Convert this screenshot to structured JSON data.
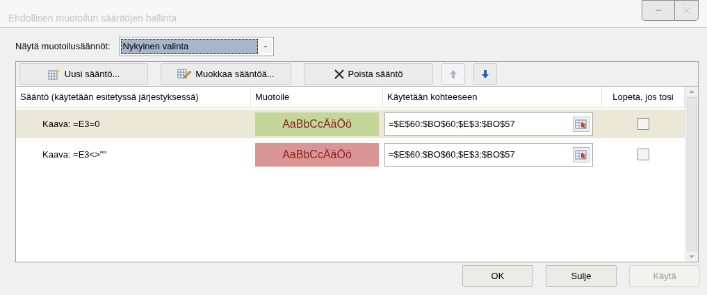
{
  "window": {
    "title": "Ehdollisen muotoilun sääntöjen hallinta"
  },
  "show_rules": {
    "label": "Näytä muotoilusäännöt:",
    "value": "Nykyinen valinta"
  },
  "toolbar": [
    {
      "kind": "new",
      "label": "Uusi sääntö...",
      "disabled": false
    },
    {
      "kind": "edit",
      "label": "Muokkaa sääntöä...",
      "disabled": false
    },
    {
      "kind": "delete",
      "label": "Poista sääntö",
      "disabled": false
    },
    {
      "kind": "up",
      "disabled": true
    },
    {
      "kind": "down",
      "disabled": false
    }
  ],
  "table": {
    "columns": [
      "Sääntö (käytetään esitetyssä järjestyksessä)",
      "Muotoile",
      "Käytetään kohteeseen",
      "Lopeta, jos tosi"
    ],
    "rows": [
      {
        "rule": "Kaava: =E3=0",
        "preview": "AaBbCcÄäÖö",
        "color": "#c4d79b",
        "applies_to": "=$E$60:$BO$60;$E$3:$BO$57",
        "stop_if_true": false,
        "selected": true
      },
      {
        "rule": "Kaava: =E3<>\"\"",
        "preview": "AaBbCcÄäÖö",
        "color": "#da9694",
        "applies_to": "=$E$60:$BO$60;$E$3:$BO$57",
        "stop_if_true": false,
        "selected": false
      }
    ]
  },
  "buttons": [
    {
      "label": "OK",
      "disabled": false
    },
    {
      "label": "Sulje",
      "disabled": false
    },
    {
      "label": "Käytä",
      "disabled": true
    }
  ]
}
